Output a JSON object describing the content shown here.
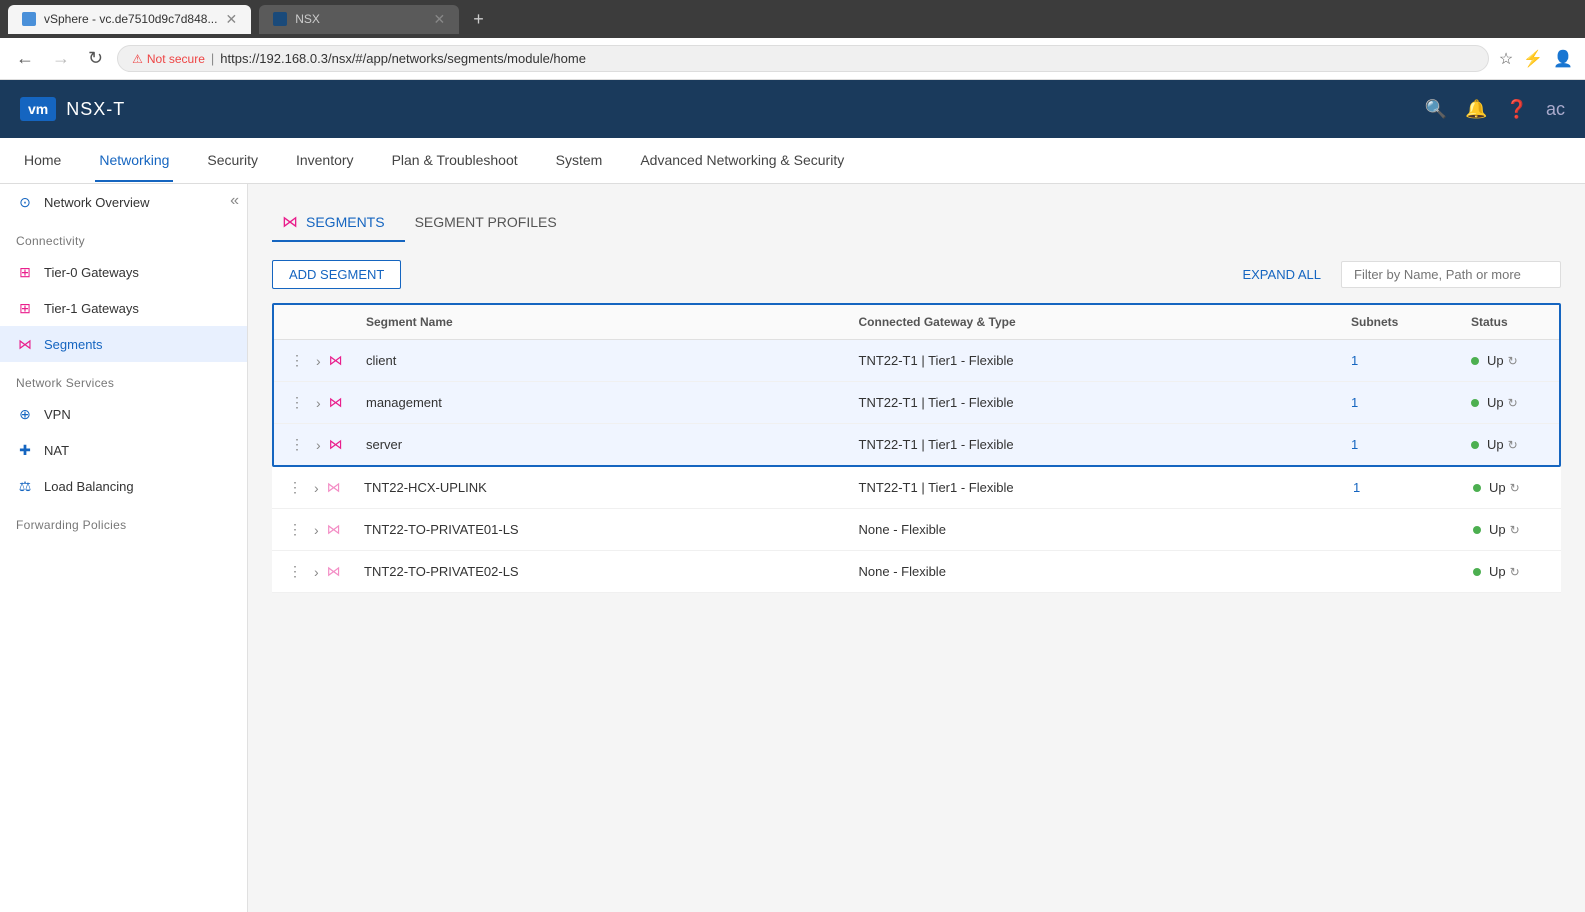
{
  "browser": {
    "tabs": [
      {
        "id": "vsphere",
        "label": "vSphere - vc.de7510d9c7d848...",
        "active": false,
        "favicon": "vsphere"
      },
      {
        "id": "nsx",
        "label": "NSX",
        "active": true,
        "favicon": "nsx"
      }
    ],
    "new_tab_icon": "+",
    "address": {
      "not_secure_label": "Not secure",
      "url": "https://192.168.0.3/nsx/#/app/networks/segments/module/home"
    }
  },
  "app": {
    "logo": "vm",
    "title": "NSX-T",
    "header_icons": [
      "search",
      "bell",
      "help",
      "user"
    ]
  },
  "nav": {
    "tabs": [
      {
        "id": "home",
        "label": "Home",
        "active": false
      },
      {
        "id": "networking",
        "label": "Networking",
        "active": true
      },
      {
        "id": "security",
        "label": "Security",
        "active": false
      },
      {
        "id": "inventory",
        "label": "Inventory",
        "active": false
      },
      {
        "id": "plan",
        "label": "Plan & Troubleshoot",
        "active": false
      },
      {
        "id": "system",
        "label": "System",
        "active": false
      },
      {
        "id": "advanced",
        "label": "Advanced Networking & Security",
        "active": false
      }
    ]
  },
  "sidebar": {
    "collapse_icon": "«",
    "items": [
      {
        "id": "network-overview",
        "label": "Network Overview",
        "icon": "⊙",
        "icon_type": "blue",
        "section": null
      },
      {
        "id": "connectivity-header",
        "label": "Connectivity",
        "is_section": true
      },
      {
        "id": "tier0-gateways",
        "label": "Tier-0 Gateways",
        "icon": "⊞",
        "icon_type": "pink"
      },
      {
        "id": "tier1-gateways",
        "label": "Tier-1 Gateways",
        "icon": "⊞",
        "icon_type": "pink"
      },
      {
        "id": "segments",
        "label": "Segments",
        "icon": "⋈",
        "icon_type": "pink",
        "active": true
      },
      {
        "id": "network-services-header",
        "label": "Network Services",
        "is_section": true
      },
      {
        "id": "vpn",
        "label": "VPN",
        "icon": "⊕",
        "icon_type": "blue"
      },
      {
        "id": "nat",
        "label": "NAT",
        "icon": "+",
        "icon_type": "blue"
      },
      {
        "id": "load-balancing",
        "label": "Load Balancing",
        "icon": "⚖",
        "icon_type": "blue"
      },
      {
        "id": "forwarding-policies-header",
        "label": "Forwarding Policies",
        "is_section": true
      }
    ]
  },
  "content": {
    "tabs": [
      {
        "id": "segments",
        "label": "SEGMENTS",
        "active": true,
        "icon": "⋈"
      },
      {
        "id": "segment-profiles",
        "label": "SEGMENT PROFILES",
        "active": false
      }
    ],
    "toolbar": {
      "add_button": "ADD SEGMENT",
      "expand_all": "EXPAND ALL",
      "filter_placeholder": "Filter by Name, Path or more"
    },
    "table": {
      "columns": [
        "",
        "Segment Name",
        "Connected Gateway & Type",
        "Subnets",
        "Status"
      ],
      "highlighted_rows": [
        {
          "name": "client",
          "gateway": "TNT22-T1 | Tier1 - Flexible",
          "subnets": "1",
          "status": "Up"
        },
        {
          "name": "management",
          "gateway": "TNT22-T1 | Tier1 - Flexible",
          "subnets": "1",
          "status": "Up"
        },
        {
          "name": "server",
          "gateway": "TNT22-T1 | Tier1 - Flexible",
          "subnets": "1",
          "status": "Up"
        }
      ],
      "other_rows": [
        {
          "name": "TNT22-HCX-UPLINK",
          "gateway": "TNT22-T1 | Tier1 - Flexible",
          "subnets": "1",
          "status": "Up"
        },
        {
          "name": "TNT22-TO-PRIVATE01-LS",
          "gateway": "None - Flexible",
          "subnets": "",
          "status": "Up"
        },
        {
          "name": "TNT22-TO-PRIVATE02-LS",
          "gateway": "None - Flexible",
          "subnets": "",
          "status": "Up"
        }
      ]
    }
  }
}
